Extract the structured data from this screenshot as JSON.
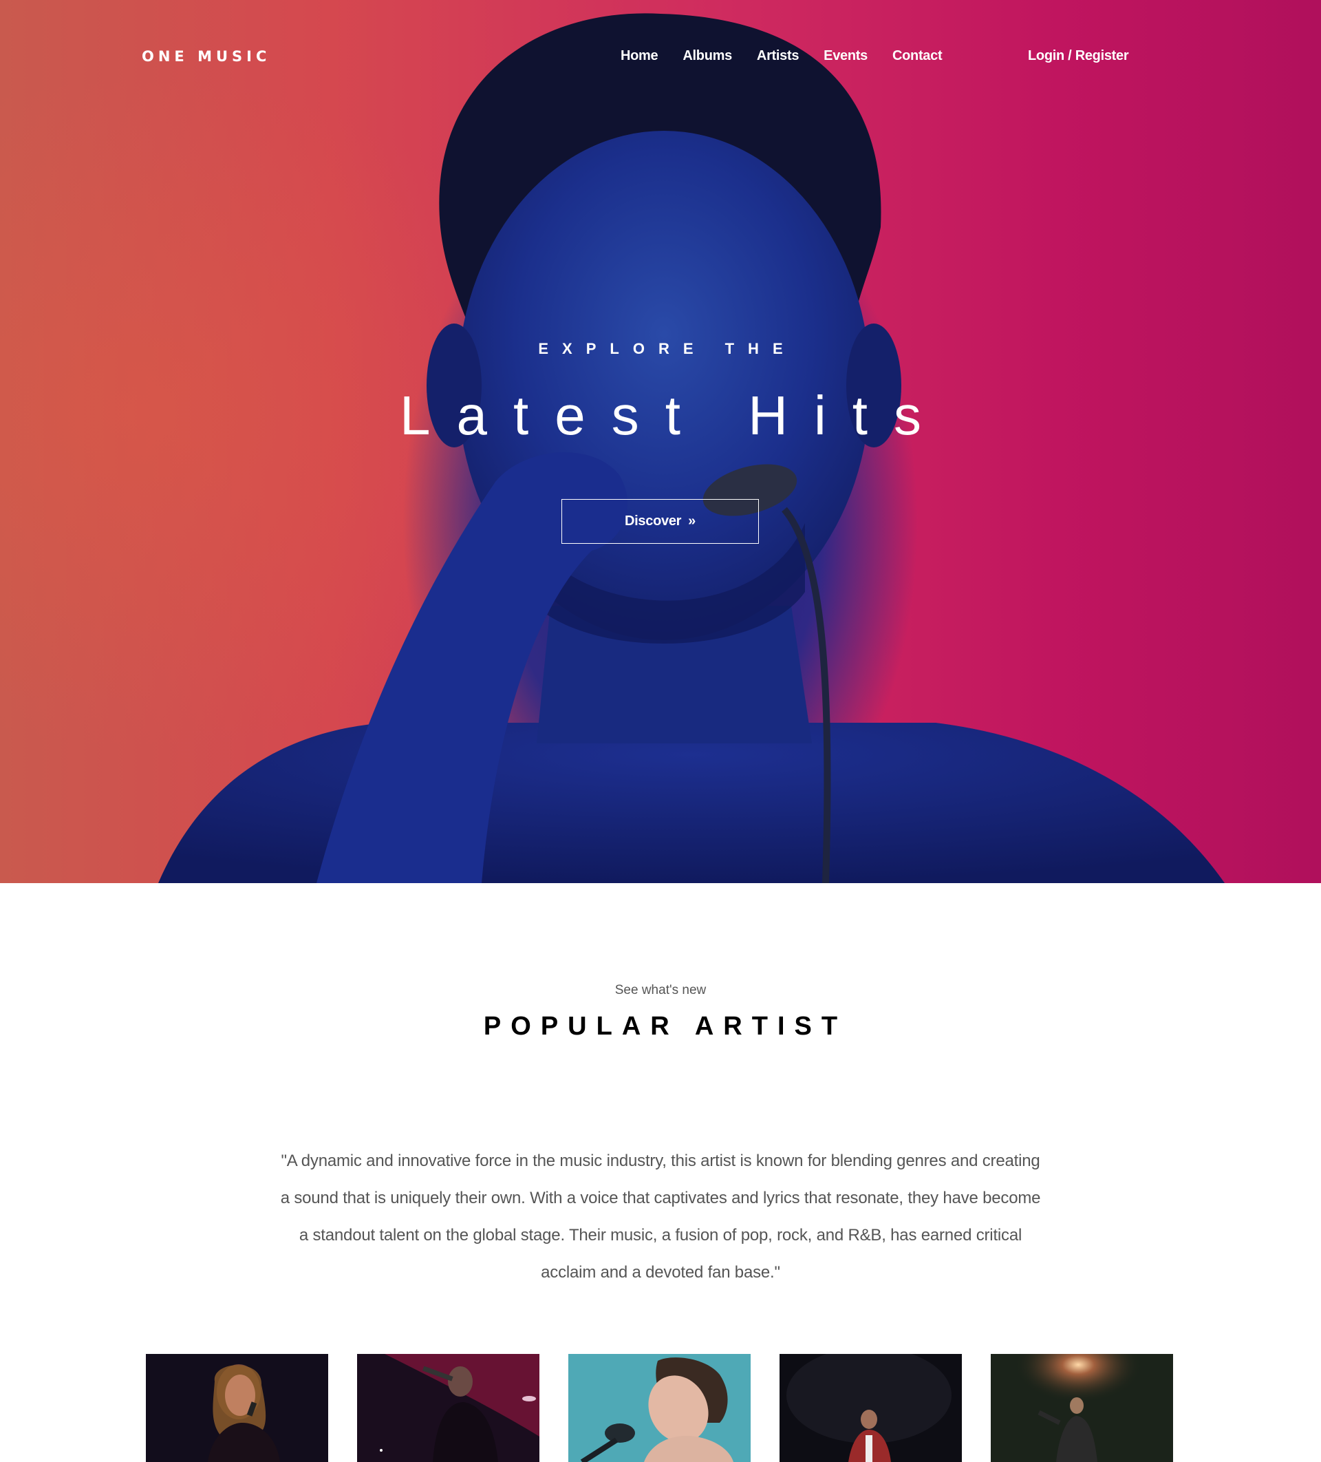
{
  "header": {
    "logo": "ONE MUSIC",
    "nav": [
      "Home",
      "Albums",
      "Artists",
      "Events",
      "Contact"
    ],
    "login": "Login / Register"
  },
  "hero": {
    "eyebrow": "EXPLORE THE",
    "title": "Latest Hits",
    "button_label": "Discover",
    "button_icon": "double-chevron-right-icon"
  },
  "popular": {
    "subheading": "See what's new",
    "title": "POPULAR ARTIST",
    "quote": "\"A dynamic and innovative force in the music industry, this artist is known for blending genres and creating a sound that is uniquely their own. With a voice that captivates and lyrics that resonate, they have become a standout talent on the global stage. Their music, a fusion of pop, rock, and R&B, has earned critical acclaim and a devoted fan base.\""
  },
  "artists": [
    {
      "image": "female-singer-photo",
      "bg": "#120d1c"
    },
    {
      "image": "rapper-red-stage-photo",
      "bg": "#1a0d1e"
    },
    {
      "image": "singer-teal-backdrop-photo",
      "bg": "#4fa9b6"
    },
    {
      "image": "guitarist-dark-stage-photo",
      "bg": "#0d0d14"
    },
    {
      "image": "performer-spotlight-photo",
      "bg": "#1b231a"
    }
  ],
  "colors": {
    "hero_gradient_start": "#c95a4e",
    "hero_gradient_end": "#b0105c",
    "hero_figure": "#1a2a8a",
    "text_dark": "#000000",
    "text_muted": "#555555"
  }
}
